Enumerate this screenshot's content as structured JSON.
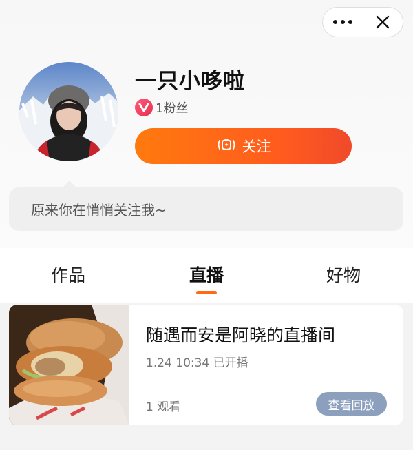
{
  "profile": {
    "name": "一只小哆啦",
    "fans": "1粉丝",
    "follow_label": "关注",
    "greeting": "原来你在悄悄关注我~"
  },
  "tabs": [
    {
      "label": "作品",
      "active": false
    },
    {
      "label": "直播",
      "active": true
    },
    {
      "label": "好物",
      "active": false
    }
  ],
  "live_card": {
    "title": "随遇而安是阿晓的直播间",
    "time": "1.24 10:34 已开播",
    "views": "1 观看",
    "replay_label": "查看回放"
  },
  "colors": {
    "accent": "#ff6a13",
    "follow_gradient_start": "#ff7a0e",
    "follow_gradient_end": "#ef4a2a",
    "replay_button": "#8ca0bd",
    "badge": "#e8304f"
  },
  "icons": {
    "more": "more-dots-icon",
    "close": "close-icon",
    "badge": "v-badge-icon",
    "live": "live-signal-icon"
  }
}
